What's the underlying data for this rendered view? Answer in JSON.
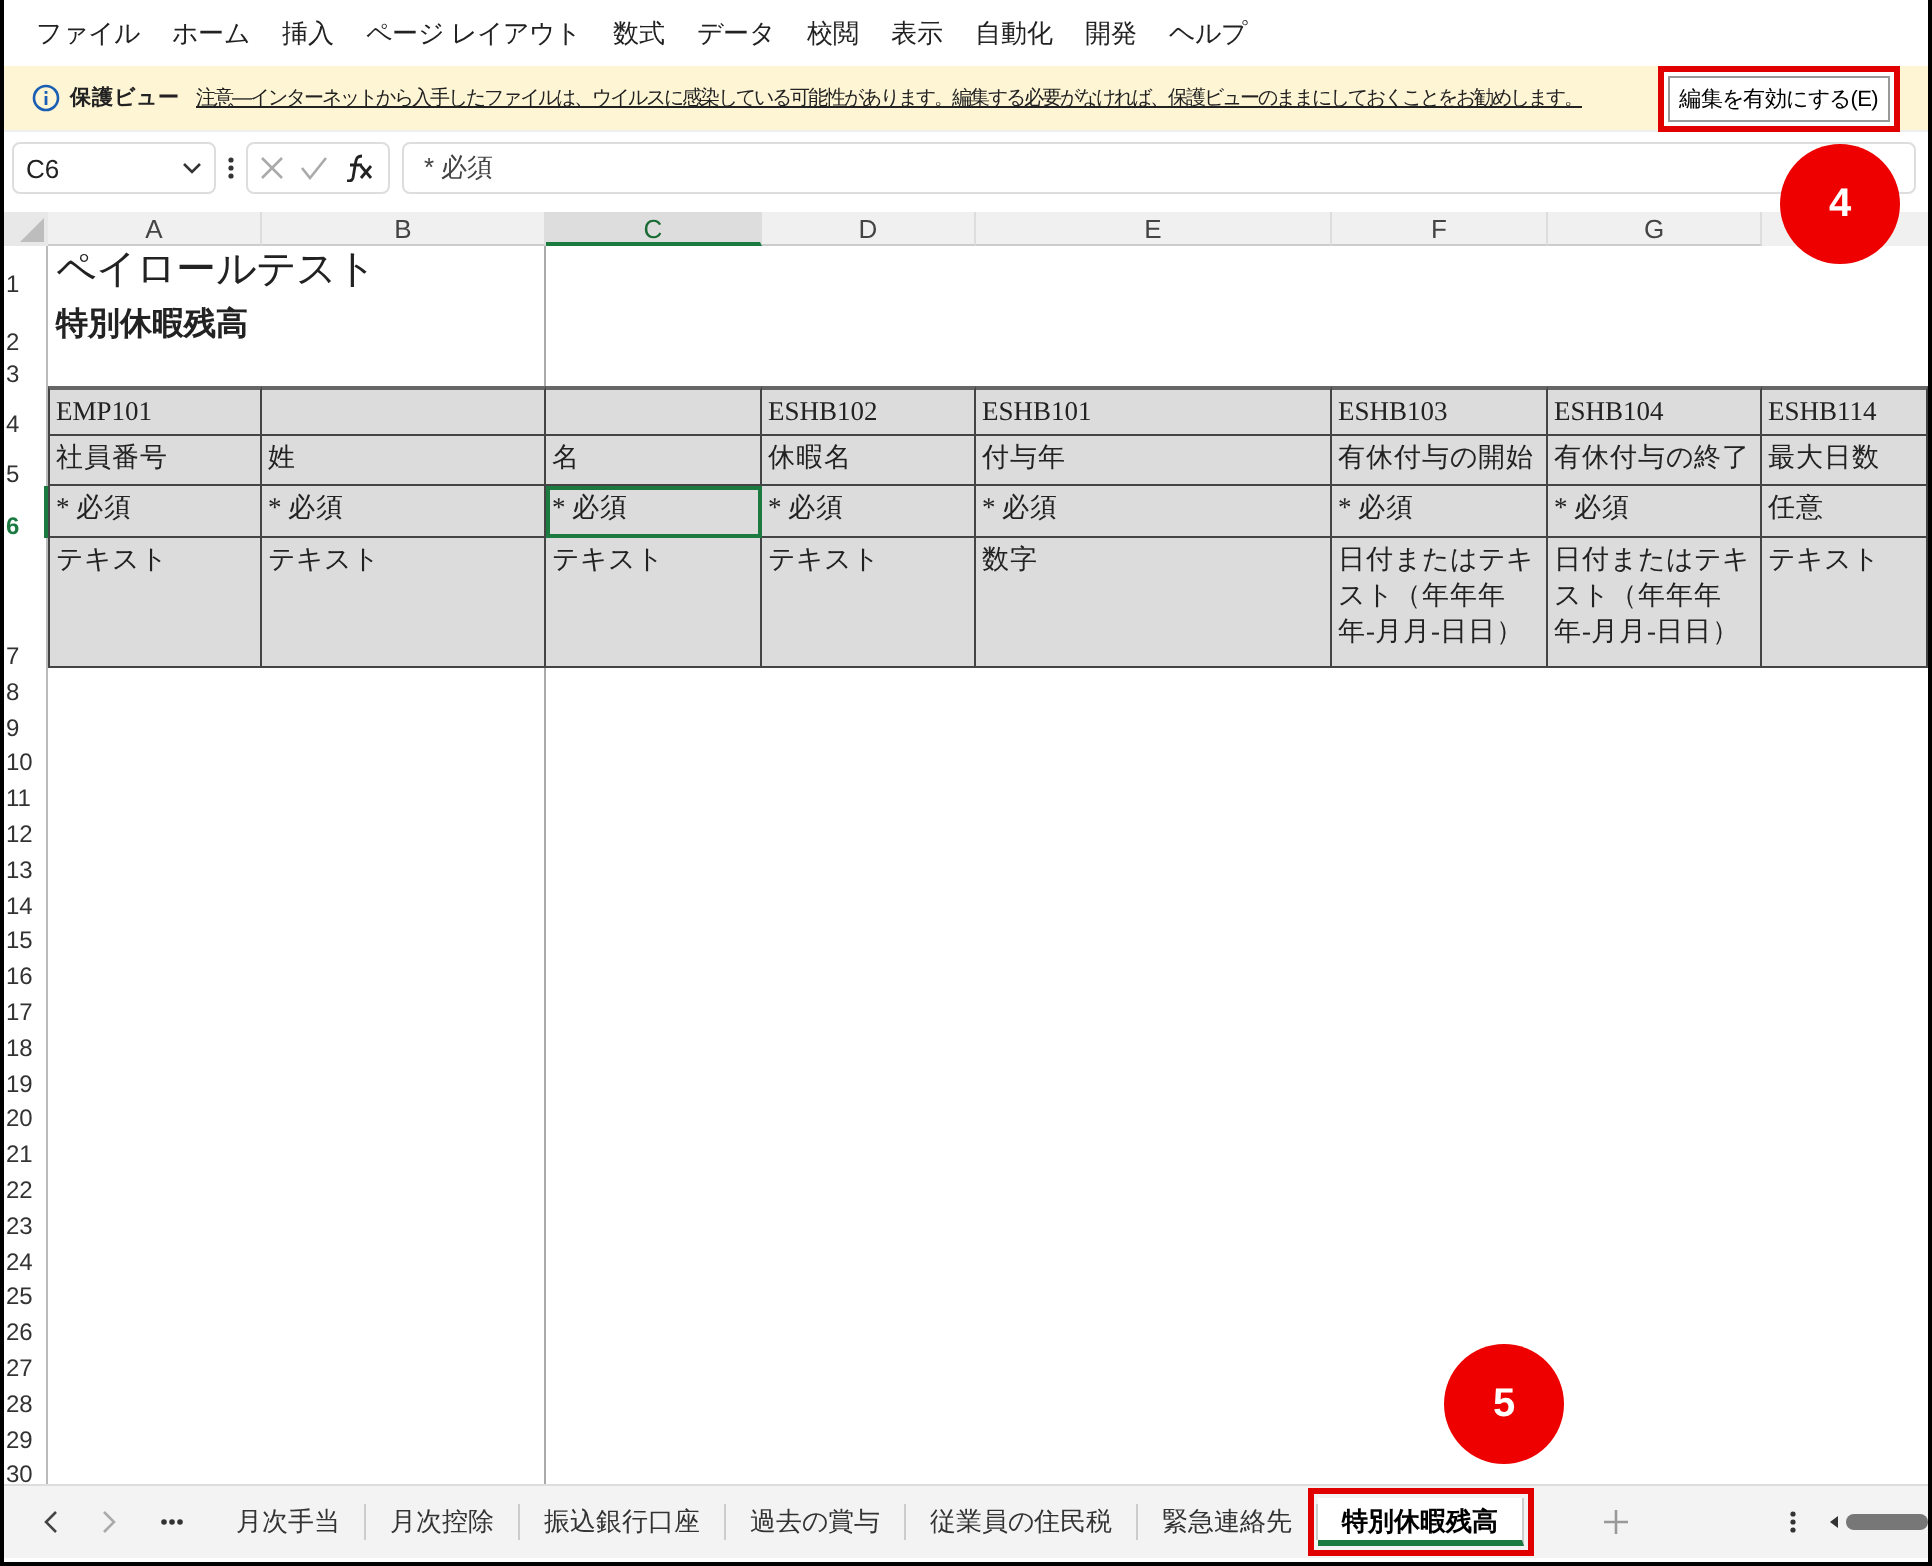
{
  "menu": [
    {
      "label": "ファイル"
    },
    {
      "label": "ホーム"
    },
    {
      "label": "挿入"
    },
    {
      "label": "ページ レイアウト"
    },
    {
      "label": "数式"
    },
    {
      "label": "データ"
    },
    {
      "label": "校閲"
    },
    {
      "label": "表示"
    },
    {
      "label": "自動化"
    },
    {
      "label": "開発"
    },
    {
      "label": "ヘルプ"
    }
  ],
  "protected_view": {
    "label": "保護ビュー",
    "message": "注意—インターネットから入手したファイルは、ウイルスに感染している可能性があります。編集する必要がなければ、保護ビューのままにしておくことをお勧めします。",
    "button": {
      "label": "編集を有効にする(E)",
      "highlighted": true,
      "callout": "4"
    }
  },
  "formula_bar": {
    "name_box": "C6",
    "formula": "* 必須"
  },
  "columns": [
    {
      "label": "A",
      "selected": false
    },
    {
      "label": "B",
      "selected": false
    },
    {
      "label": "C",
      "selected": true
    },
    {
      "label": "D",
      "selected": false
    },
    {
      "label": "E",
      "selected": false
    },
    {
      "label": "F",
      "selected": false
    },
    {
      "label": "G",
      "selected": false
    }
  ],
  "row_numbers": [
    {
      "label": "1",
      "selected": false
    },
    {
      "label": "2",
      "selected": false
    },
    {
      "label": "3",
      "selected": false
    },
    {
      "label": "4",
      "selected": false
    },
    {
      "label": "5",
      "selected": false
    },
    {
      "label": "6",
      "selected": true
    },
    {
      "label": "7",
      "selected": false
    },
    {
      "label": "8",
      "selected": false
    },
    {
      "label": "9",
      "selected": false
    },
    {
      "label": "10",
      "selected": false
    },
    {
      "label": "11",
      "selected": false
    },
    {
      "label": "12",
      "selected": false
    },
    {
      "label": "13",
      "selected": false
    },
    {
      "label": "14",
      "selected": false
    },
    {
      "label": "15",
      "selected": false
    },
    {
      "label": "16",
      "selected": false
    },
    {
      "label": "17",
      "selected": false
    },
    {
      "label": "18",
      "selected": false
    },
    {
      "label": "19",
      "selected": false
    },
    {
      "label": "20",
      "selected": false
    },
    {
      "label": "21",
      "selected": false
    },
    {
      "label": "22",
      "selected": false
    },
    {
      "label": "23",
      "selected": false
    },
    {
      "label": "24",
      "selected": false
    },
    {
      "label": "25",
      "selected": false
    },
    {
      "label": "26",
      "selected": false
    },
    {
      "label": "27",
      "selected": false
    },
    {
      "label": "28",
      "selected": false
    },
    {
      "label": "29",
      "selected": false
    },
    {
      "label": "30",
      "selected": false
    }
  ],
  "sheet": {
    "title": "ペイロールテスト",
    "subtitle": "特別休暇残高",
    "rows": [
      {
        "cells": [
          {
            "text": "EMP101",
            "selected": false
          },
          {
            "text": "",
            "selected": false
          },
          {
            "text": "",
            "selected": false
          },
          {
            "text": "ESHB102",
            "selected": false
          },
          {
            "text": "ESHB101",
            "selected": false
          },
          {
            "text": "ESHB103",
            "selected": false
          },
          {
            "text": "ESHB104",
            "selected": false
          },
          {
            "text": "ESHB114",
            "selected": false
          }
        ]
      },
      {
        "cells": [
          {
            "text": "社員番号",
            "selected": false
          },
          {
            "text": "姓",
            "selected": false
          },
          {
            "text": "名",
            "selected": false
          },
          {
            "text": "休暇名",
            "selected": false
          },
          {
            "text": "付与年",
            "selected": false
          },
          {
            "text": "有休付与の開始",
            "selected": false
          },
          {
            "text": "有休付与の終了",
            "selected": false
          },
          {
            "text": "最大日数",
            "selected": false
          }
        ]
      },
      {
        "cells": [
          {
            "text": "* 必須",
            "selected": false
          },
          {
            "text": "* 必須",
            "selected": false
          },
          {
            "text": "* 必須",
            "selected": true
          },
          {
            "text": "* 必須",
            "selected": false
          },
          {
            "text": "* 必須",
            "selected": false
          },
          {
            "text": "* 必須",
            "selected": false
          },
          {
            "text": "* 必須",
            "selected": false
          },
          {
            "text": "任意",
            "selected": false
          }
        ]
      },
      {
        "cells": [
          {
            "text": "テキスト",
            "selected": false
          },
          {
            "text": "テキスト",
            "selected": false
          },
          {
            "text": "テキスト",
            "selected": false
          },
          {
            "text": "テキスト",
            "selected": false
          },
          {
            "text": "数字",
            "selected": false
          },
          {
            "text": "日付またはテキスト（年年年年-月月-日日）",
            "selected": false
          },
          {
            "text": "日付またはテキスト（年年年年-月月-日日）",
            "selected": false
          },
          {
            "text": "テキスト",
            "selected": false
          }
        ]
      }
    ]
  },
  "sheet_tabs": [
    {
      "label": "月次手当",
      "selected": false,
      "highlighted": false
    },
    {
      "label": "月次控除",
      "selected": false,
      "highlighted": false
    },
    {
      "label": "振込銀行口座",
      "selected": false,
      "highlighted": false
    },
    {
      "label": "過去の賞与",
      "selected": false,
      "highlighted": false
    },
    {
      "label": "従業員の住民税",
      "selected": false,
      "highlighted": false
    },
    {
      "label": "緊急連絡先",
      "selected": false,
      "highlighted": false
    },
    {
      "label": "特別休暇残高",
      "selected": true,
      "highlighted": true,
      "callout": "5"
    }
  ]
}
